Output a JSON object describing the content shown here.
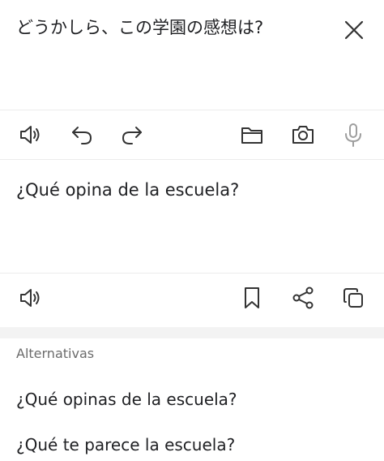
{
  "source": {
    "text": "どうかしら、この学園の感想は?"
  },
  "source_toolbar": {
    "icons": [
      "speaker-icon",
      "undo-icon",
      "redo-icon",
      "folder-icon",
      "camera-icon",
      "microphone-icon"
    ]
  },
  "target": {
    "text": "¿Qué opina de la escuela?"
  },
  "target_toolbar": {
    "icons": [
      "speaker-icon",
      "bookmark-icon",
      "share-icon",
      "copy-icon"
    ]
  },
  "alternatives": {
    "heading": "Alternativas",
    "items": [
      {
        "text": "¿Qué opinas de la escuela?"
      },
      {
        "text": "¿Qué te parece la escuela?"
      }
    ]
  },
  "colors": {
    "icon": "#333333",
    "icon_disabled": "#9e9e9e",
    "divider": "#ececec",
    "band": "#f3f3f3"
  }
}
